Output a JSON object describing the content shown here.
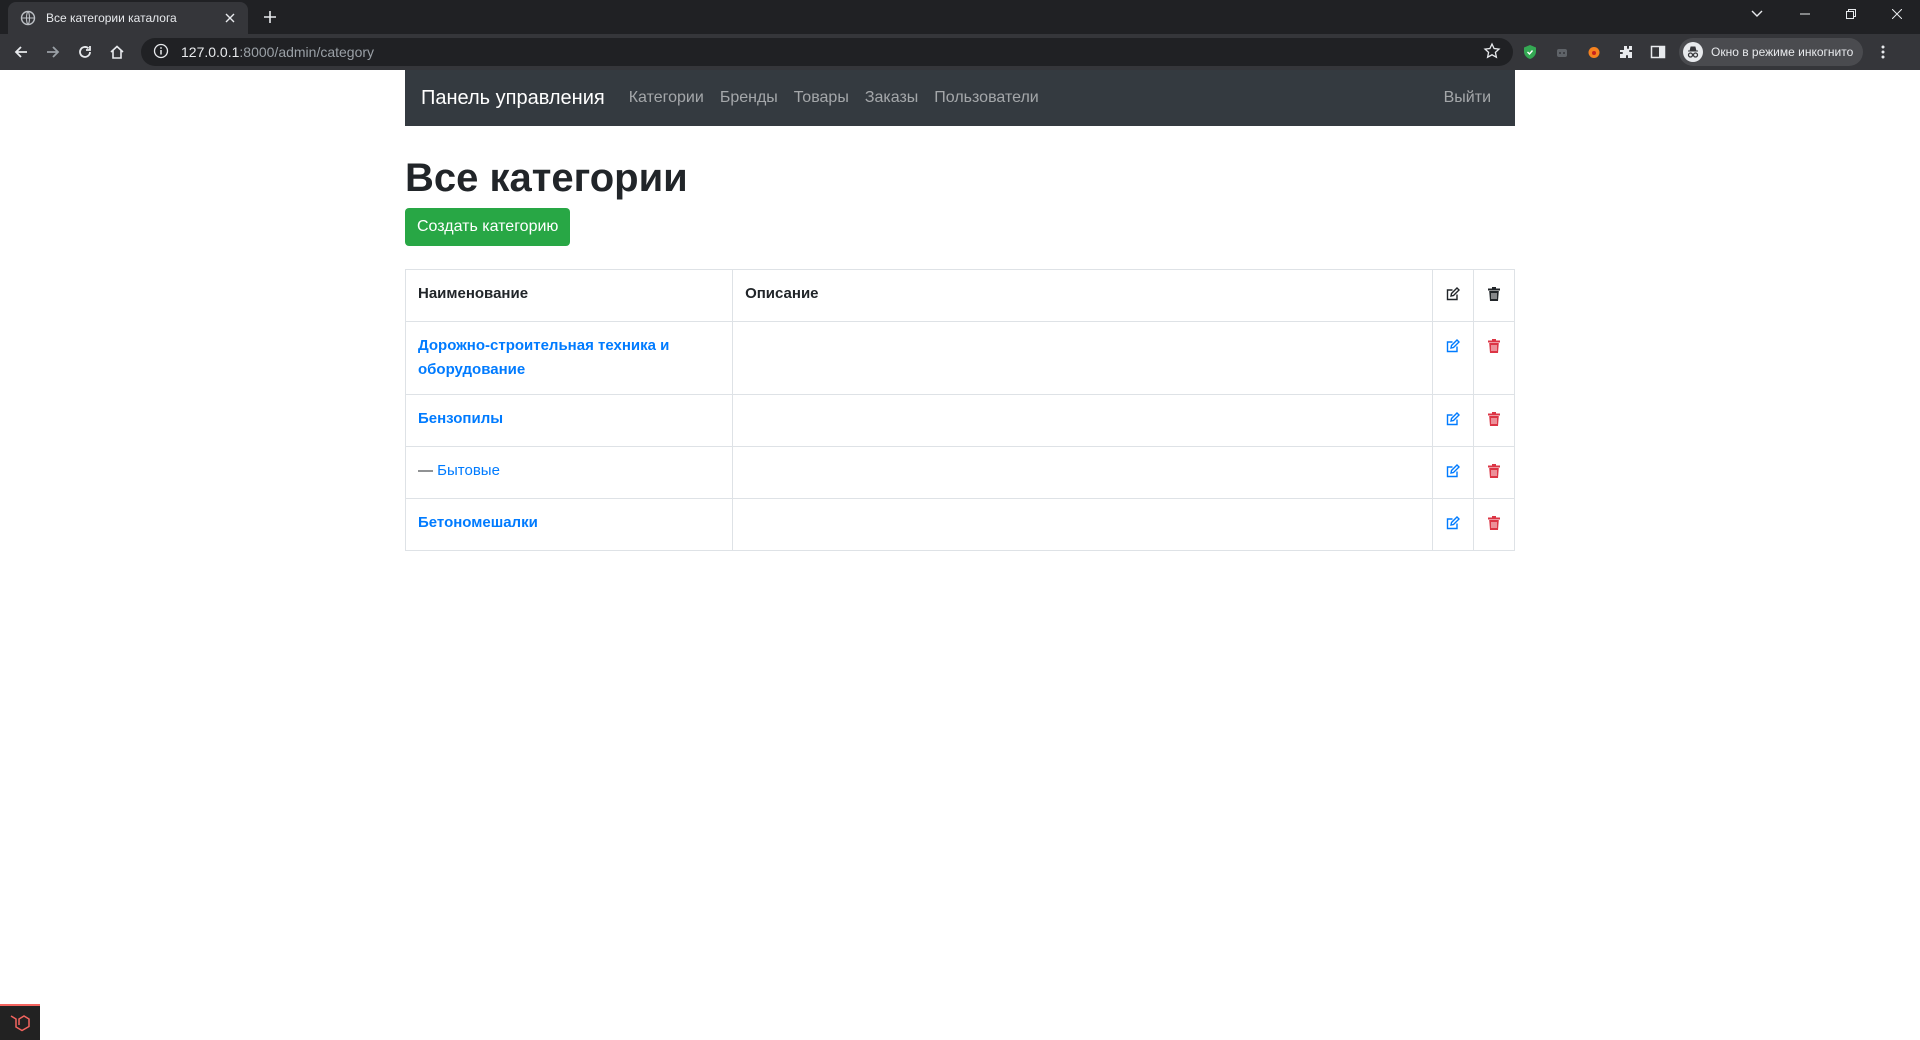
{
  "browser": {
    "tab_title": "Все категории каталога",
    "url_host": "127.0.0.1",
    "url_rest": ":8000/admin/category",
    "profile_label": "Окно в режиме инкогнито"
  },
  "navbar": {
    "brand": "Панель управления",
    "links": [
      "Категории",
      "Бренды",
      "Товары",
      "Заказы",
      "Пользователи"
    ],
    "logout": "Выйти"
  },
  "page": {
    "title": "Все категории",
    "create_button": "Создать категорию"
  },
  "table": {
    "headers": {
      "name": "Наименование",
      "description": "Описание"
    },
    "rows": [
      {
        "name": "Дорожно-строительная техника и оборудование",
        "description": "",
        "prefix": ""
      },
      {
        "name": "Бензопилы",
        "description": "",
        "prefix": ""
      },
      {
        "name": "Бытовые",
        "description": "",
        "prefix": "—"
      },
      {
        "name": "Бетономешалки",
        "description": "",
        "prefix": ""
      }
    ]
  },
  "colors": {
    "navbar_bg": "#343a40",
    "create_button_bg": "#28a745",
    "link": "#007bff",
    "delete_icon": "#dc3545"
  },
  "icons": {
    "edit": "edit-icon",
    "delete": "trash-icon"
  }
}
